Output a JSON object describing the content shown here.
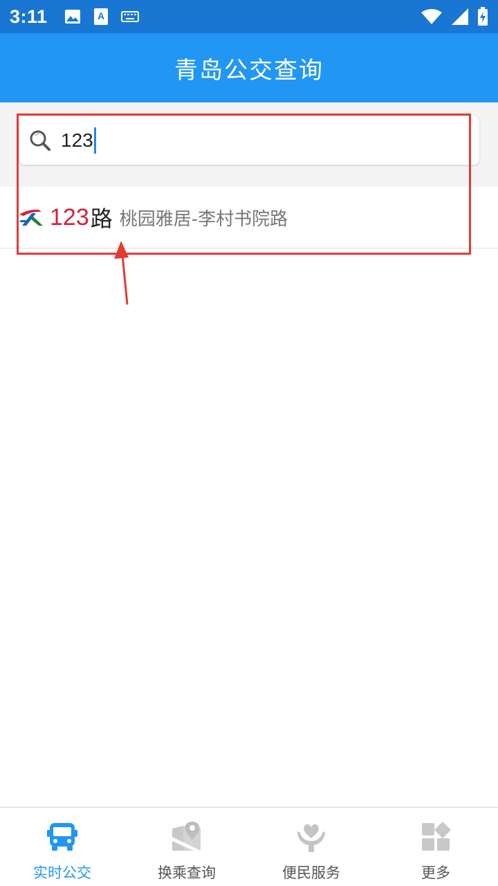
{
  "status_bar": {
    "time": "3:11",
    "left_icons": [
      "image-icon",
      "text-a-icon",
      "keyboard-icon"
    ],
    "right_icons": [
      "wifi-icon",
      "signal-icon",
      "battery-charging-icon"
    ]
  },
  "app_bar": {
    "title": "青岛公交查询"
  },
  "search": {
    "icon": "search-icon",
    "value": "123"
  },
  "results": [
    {
      "logo": "bus-company-logo-icon",
      "route_number": "123",
      "route_suffix": "路",
      "description": "桃园雅居-李村书院路"
    }
  ],
  "bottom_nav": {
    "items": [
      {
        "label": "实时公交",
        "icon": "bus-icon",
        "active": true
      },
      {
        "label": "换乘查询",
        "icon": "map-pin-icon",
        "active": false
      },
      {
        "label": "便民服务",
        "icon": "heart-hand-icon",
        "active": false
      },
      {
        "label": "更多",
        "icon": "grid-more-icon",
        "active": false
      }
    ]
  },
  "colors": {
    "status_bar": "#1976d2",
    "app_bar": "#2196f3",
    "route_number": "#d3213a",
    "active_tab": "#2196f3",
    "annotation": "#e53935"
  }
}
